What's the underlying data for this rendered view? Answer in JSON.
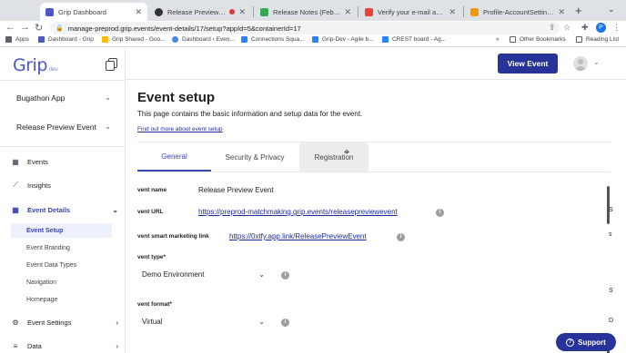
{
  "browser": {
    "tabs": [
      {
        "title": "Grip Dashboard",
        "active": true
      },
      {
        "title": "Release Preview Event M",
        "active": false
      },
      {
        "title": "Release Notes (February 202",
        "active": false
      },
      {
        "title": "Verify your e-mail address fo",
        "active": false
      },
      {
        "title": "Profile-AccountSetting -> De",
        "active": false
      }
    ],
    "url": "manage-preprod.grip.events/event-details/17/setup?appId=5&containerId=17",
    "profile_initial": "P",
    "bookmarks": [
      "Apps",
      "Dashboard - Grip",
      "Grip Shared - Goo...",
      "Dashboard ‹ Even...",
      "Connections Squa...",
      "Grip-Dev - Agile b...",
      "CREST board - Ag...",
      "»",
      "Other Bookmarks",
      "Reading List"
    ]
  },
  "sidebar": {
    "logo": "Grip",
    "logo_sub": "dev",
    "app_select": "Bugathon App",
    "event_select": "Release Preview Event",
    "nav": {
      "events": "Events",
      "insights": "Insights",
      "event_details": "Event Details",
      "sub_items": [
        "Event Setup",
        "Event Branding",
        "Event Data Types",
        "Navigation",
        "Homepage"
      ],
      "event_settings": "Event Settings",
      "data": "Data"
    }
  },
  "header": {
    "view_event": "View Event"
  },
  "main": {
    "title": "Event setup",
    "description": "This page contains the basic information and setup data for the event.",
    "learn_more": "Find out more about event setup",
    "tabs": [
      "General",
      "Security & Privacy",
      "Registration"
    ],
    "fields": {
      "name_label": "vent name",
      "name_value": "Release Preview Event",
      "url_label": "vent URL",
      "url_value": "https://preprod-matchmaking.grip.events/releasepreviewevent",
      "smart_label": "vent smart marketing link",
      "smart_value": "https://0xtfy.app.link/ReleasePreviewEvent",
      "type_label": "vent type*",
      "type_value": "Demo Environment",
      "format_label": "vent format*",
      "format_value": "Virtual"
    },
    "edge_chars": [
      "I",
      "S",
      "s",
      "S",
      "D"
    ]
  },
  "support": "Support"
}
